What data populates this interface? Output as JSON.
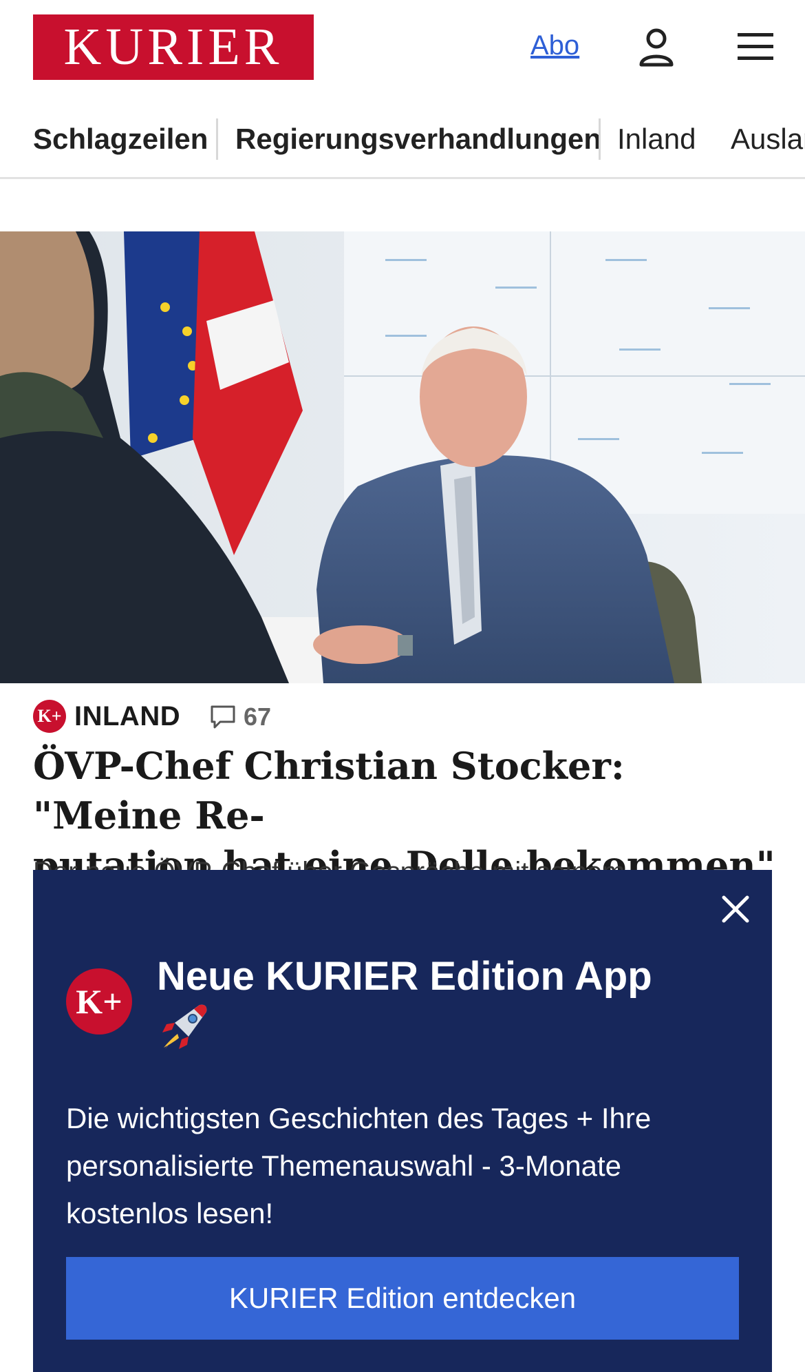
{
  "header": {
    "logo_text": "KURIER",
    "abo_label": "Abo",
    "user_icon": "user-icon",
    "menu_icon": "hamburger-menu-icon"
  },
  "nav": {
    "items": [
      {
        "label": "Schlagzeilen"
      },
      {
        "label": "Regierungsverhandlungen"
      },
      {
        "label": "Inland"
      },
      {
        "label": "Ausland"
      }
    ]
  },
  "article": {
    "badge": "K+",
    "category": "INLAND",
    "comments": "67",
    "headline_line1": "ÖVP-Chef Christian Stocker: \"Meine Re-",
    "headline_line2": "putation hat eine Delle bekommen\"",
    "teaser": "Der neue ÖVP-Chef über Gespräche mit seinem"
  },
  "promo": {
    "logo": "K+",
    "title": "Neue KURIER Edition App",
    "text": "Die wichtigsten Geschichten des Tages + Ihre personalisierte Themenauswahl - 3-Monate kostenlos lesen!",
    "cta_label": "KURIER Edition entdecken",
    "close_icon": "close-icon",
    "rocket_icon": "rocket-icon"
  },
  "colors": {
    "brand_red": "#c8102e",
    "promo_bg": "#17275b",
    "cta_blue": "#3566d6",
    "link_blue": "#2e5fd6"
  }
}
